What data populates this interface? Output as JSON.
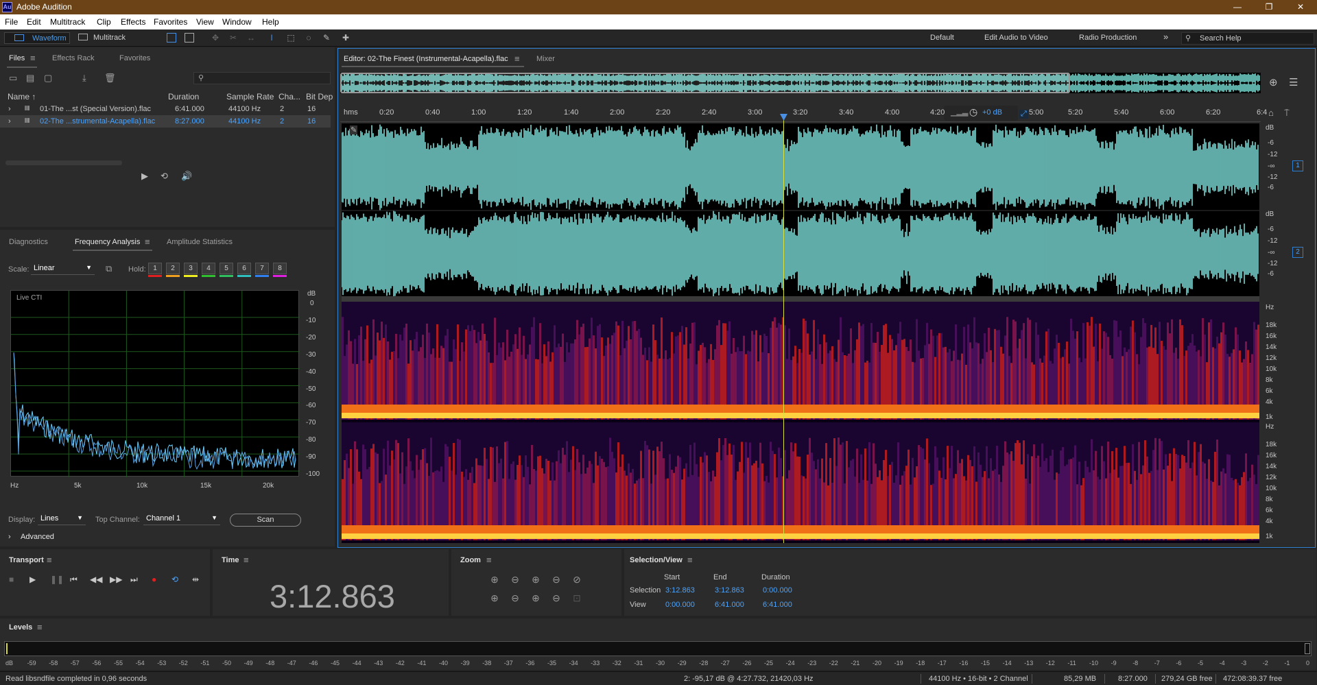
{
  "window": {
    "title": "Adobe Audition",
    "logo": "Au",
    "minimize": "—",
    "restore": "❐",
    "close": "✕"
  },
  "menu": [
    "File",
    "Edit",
    "Multitrack",
    "Clip",
    "Effects",
    "Favorites",
    "View",
    "Window",
    "Help"
  ],
  "toolbar": {
    "waveform": "Waveform",
    "multitrack": "Multitrack",
    "workspaces": [
      "Default",
      "Edit Audio to Video",
      "Radio Production"
    ],
    "more": "»",
    "search_placeholder": "Search Help"
  },
  "files": {
    "tabs": [
      "Files",
      "Effects Rack",
      "Favorites"
    ],
    "columns": [
      "Name ↑",
      "Duration",
      "Sample Rate",
      "Cha...",
      "Bit Dep"
    ],
    "rows": [
      {
        "name": "01-The ...st (Special Version).flac",
        "duration": "6:41.000",
        "rate": "44100 Hz",
        "ch": "2",
        "bits": "16"
      },
      {
        "name": "02-The ...strumental-Acapella).flac",
        "duration": "8:27.000",
        "rate": "44100 Hz",
        "ch": "2",
        "bits": "16"
      }
    ],
    "search_icon": "⚲"
  },
  "analysis": {
    "tabs": [
      "Diagnostics",
      "Frequency Analysis",
      "Amplitude Statistics"
    ],
    "scale_label": "Scale:",
    "scale_value": "Linear",
    "hold_label": "Hold:",
    "holds": [
      "1",
      "2",
      "3",
      "4",
      "5",
      "6",
      "7",
      "8"
    ],
    "hold_colors": [
      "#e02020",
      "#f0a020",
      "#f0f020",
      "#30c030",
      "#30c060",
      "#30c0c0",
      "#3080f0",
      "#e020e0"
    ],
    "live_cti": "Live CTI",
    "db_unit": "dB",
    "db_ticks": [
      "0",
      "-10",
      "-20",
      "-30",
      "-40",
      "-50",
      "-60",
      "-70",
      "-80",
      "-90",
      "-100"
    ],
    "hz_ticks": [
      "Hz",
      "5k",
      "10k",
      "15k",
      "20k"
    ],
    "display_label": "Display:",
    "display_value": "Lines",
    "top_channel_label": "Top Channel:",
    "top_channel_value": "Channel 1",
    "scan": "Scan",
    "advanced": "Advanced"
  },
  "editor": {
    "tab": "Editor: 02-The Finest (Instrumental-Acapella).flac",
    "mixer": "Mixer",
    "ruler": [
      "hms",
      "0:20",
      "0:40",
      "1:00",
      "1:20",
      "1:40",
      "2:00",
      "2:20",
      "2:40",
      "3:00",
      "3:20",
      "3:40",
      "4:00",
      "4:20",
      "5:00",
      "5:20",
      "5:40",
      "6:00",
      "6:20",
      "6:4"
    ],
    "gain": "+0 dB",
    "wave_db": [
      "dB",
      "-6",
      "-12",
      "-∞",
      "-12",
      "-6"
    ],
    "channels": [
      "1",
      "2"
    ],
    "spec_hz": [
      "Hz",
      "18k",
      "16k",
      "14k",
      "12k",
      "10k",
      "8k",
      "6k",
      "4k",
      "1k"
    ]
  },
  "transport": {
    "title": "Transport"
  },
  "time": {
    "title": "Time",
    "value": "3:12.863"
  },
  "zoom": {
    "title": "Zoom"
  },
  "selection": {
    "title": "Selection/View",
    "headers": [
      "Start",
      "End",
      "Duration"
    ],
    "rows": [
      {
        "label": "Selection",
        "start": "3:12.863",
        "end": "3:12.863",
        "duration": "0:00.000"
      },
      {
        "label": "View",
        "start": "0:00.000",
        "end": "6:41.000",
        "duration": "6:41.000"
      }
    ]
  },
  "levels": {
    "title": "Levels",
    "ticks": [
      "dB",
      "-59",
      "-58",
      "-57",
      "-56",
      "-55",
      "-54",
      "-53",
      "-52",
      "-51",
      "-50",
      "-49",
      "-48",
      "-47",
      "-46",
      "-45",
      "-44",
      "-43",
      "-42",
      "-41",
      "-40",
      "-39",
      "-38",
      "-37",
      "-36",
      "-35",
      "-34",
      "-33",
      "-32",
      "-31",
      "-30",
      "-29",
      "-28",
      "-27",
      "-26",
      "-25",
      "-24",
      "-23",
      "-22",
      "-21",
      "-20",
      "-19",
      "-18",
      "-17",
      "-16",
      "-15",
      "-14",
      "-13",
      "-12",
      "-11",
      "-10",
      "-9",
      "-8",
      "-7",
      "-6",
      "-5",
      "-4",
      "-3",
      "-2",
      "-1",
      "0"
    ]
  },
  "status": {
    "message": "Read libsndfile completed in 0,96 seconds",
    "cursor": "2: -95,17 dB @ 4:27.732, 21420,03 Hz",
    "format": "44100 Hz • 16-bit • 2 Channel",
    "size": "85,29 MB",
    "duration": "8:27.000",
    "free": "279,24 GB free",
    "free_time": "472:08:39.37 free"
  }
}
